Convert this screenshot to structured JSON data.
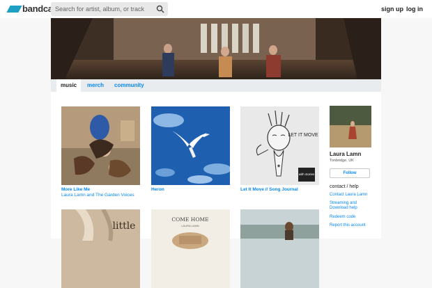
{
  "header": {
    "logo_text": "bandcamp",
    "search_placeholder": "Search for artist, album, or track",
    "signup": "sign up",
    "login": "log in"
  },
  "tabs": [
    {
      "label": "music",
      "active": true
    },
    {
      "label": "merch",
      "active": false
    },
    {
      "label": "community",
      "active": false
    }
  ],
  "albums": [
    {
      "title": "More Like Me",
      "artist": "Laura Lamn and The Garden Voices"
    },
    {
      "title": "Heron",
      "artist": ""
    },
    {
      "title": "Let It Move // Song Journal",
      "artist": ""
    }
  ],
  "cover_text": {
    "let_it_move": "LET IT MOVE",
    "with_stories": "with stories",
    "come_home": "COME HOME",
    "laura_lamn_small": "LAURA LAMN",
    "little": "little"
  },
  "band": {
    "name": "Laura Lamn",
    "location": "Tonbridge, UK",
    "follow_label": "Follow"
  },
  "contact": {
    "heading": "contact / help",
    "links": [
      "Contact Laura Lamn",
      "Streaming and Download help",
      "Redeem code",
      "Report this account"
    ]
  },
  "colors": {
    "link": "#0687f5",
    "logo": "#1da0c3"
  }
}
